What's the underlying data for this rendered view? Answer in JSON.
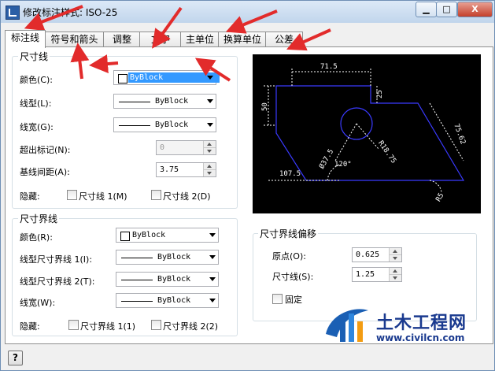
{
  "window": {
    "title": "修改标注样式: ISO-25",
    "close_label": "X"
  },
  "tabs": [
    {
      "label": "标注线"
    },
    {
      "label": "符号和箭头"
    },
    {
      "label": "调整"
    },
    {
      "label": "文字"
    },
    {
      "label": "主单位"
    },
    {
      "label": "换算单位"
    },
    {
      "label": "公差"
    }
  ],
  "dim_line": {
    "group_label": "尺寸线",
    "color_label": "颜色(C):",
    "color_value": "ByBlock",
    "linetype_label": "线型(L):",
    "linetype_value": "ByBlock",
    "lineweight_label": "线宽(G):",
    "lineweight_value": "ByBlock",
    "extend_label": "超出标记(N):",
    "extend_value": "0",
    "baseline_label": "基线间距(A):",
    "baseline_value": "3.75",
    "suppress_label": "隐藏:",
    "suppress_1": "尺寸线 1(M)",
    "suppress_2": "尺寸线 2(D)"
  },
  "ext_line": {
    "group_label": "尺寸界线",
    "color_label": "颜色(R):",
    "color_value": "ByBlock",
    "linetype1_label": "线型尺寸界线 1(I):",
    "linetype1_value": "ByBlock",
    "linetype2_label": "线型尺寸界线 2(T):",
    "linetype2_value": "ByBlock",
    "lineweight_label": "线宽(W):",
    "lineweight_value": "ByBlock",
    "suppress_label": "隐藏:",
    "suppress_1": "尺寸界线 1(1)",
    "suppress_2": "尺寸界线 2(2)"
  },
  "offset": {
    "group_label": "尺寸界线偏移",
    "origin_label": "原点(O):",
    "origin_value": "0.625",
    "dimline_label": "尺寸线(S):",
    "dimline_value": "1.25",
    "fixed_label": "固定"
  },
  "preview": {
    "dim_top": "71.5",
    "dim_left": "50",
    "dim_right_small": "25",
    "dim_slant": "75.62",
    "dim_dia": "Ø37.5",
    "dim_radius": "R18.75",
    "dim_angle": "120°",
    "dim_base": "107.5",
    "dim_corner": "R5",
    "colors": {
      "bg": "#000000",
      "outline": "#3a3aff",
      "dim": "#ffffff"
    }
  },
  "help_label": "?",
  "watermark": {
    "title": "土木工程网",
    "url": "www.civilcn.com"
  }
}
